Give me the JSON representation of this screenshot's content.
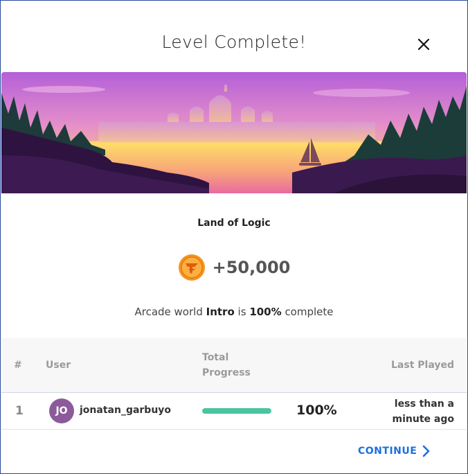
{
  "modal": {
    "title": "Level Complete!",
    "close_icon": "close-icon"
  },
  "world": {
    "name": "Land of Logic"
  },
  "reward": {
    "icon": "coin-icon",
    "amount": "+50,000",
    "coin_color": "#f7931e"
  },
  "completion": {
    "prefix": "Arcade world",
    "world": "Intro",
    "is": "is",
    "percent": "100%",
    "suffix": "complete"
  },
  "table": {
    "headers": {
      "rank": "#",
      "user": "User",
      "progress_line1": "Total",
      "progress_line2": "Progress",
      "last_played": "Last Played"
    },
    "rows": [
      {
        "rank": "1",
        "avatar_initials": "JO",
        "avatar_color": "#8c5a9b",
        "username": "jonatan_garbuyo",
        "progress_value": 1.0,
        "progress_label": "100%",
        "last_played_line1": "less than a",
        "last_played_line2": "minute ago"
      }
    ]
  },
  "footer": {
    "continue_label": "CONTINUE",
    "continue_icon": "chevron-right-icon",
    "accent_color": "#1a6fe0"
  },
  "colors": {
    "progress_fill": "#4ac3a0"
  }
}
